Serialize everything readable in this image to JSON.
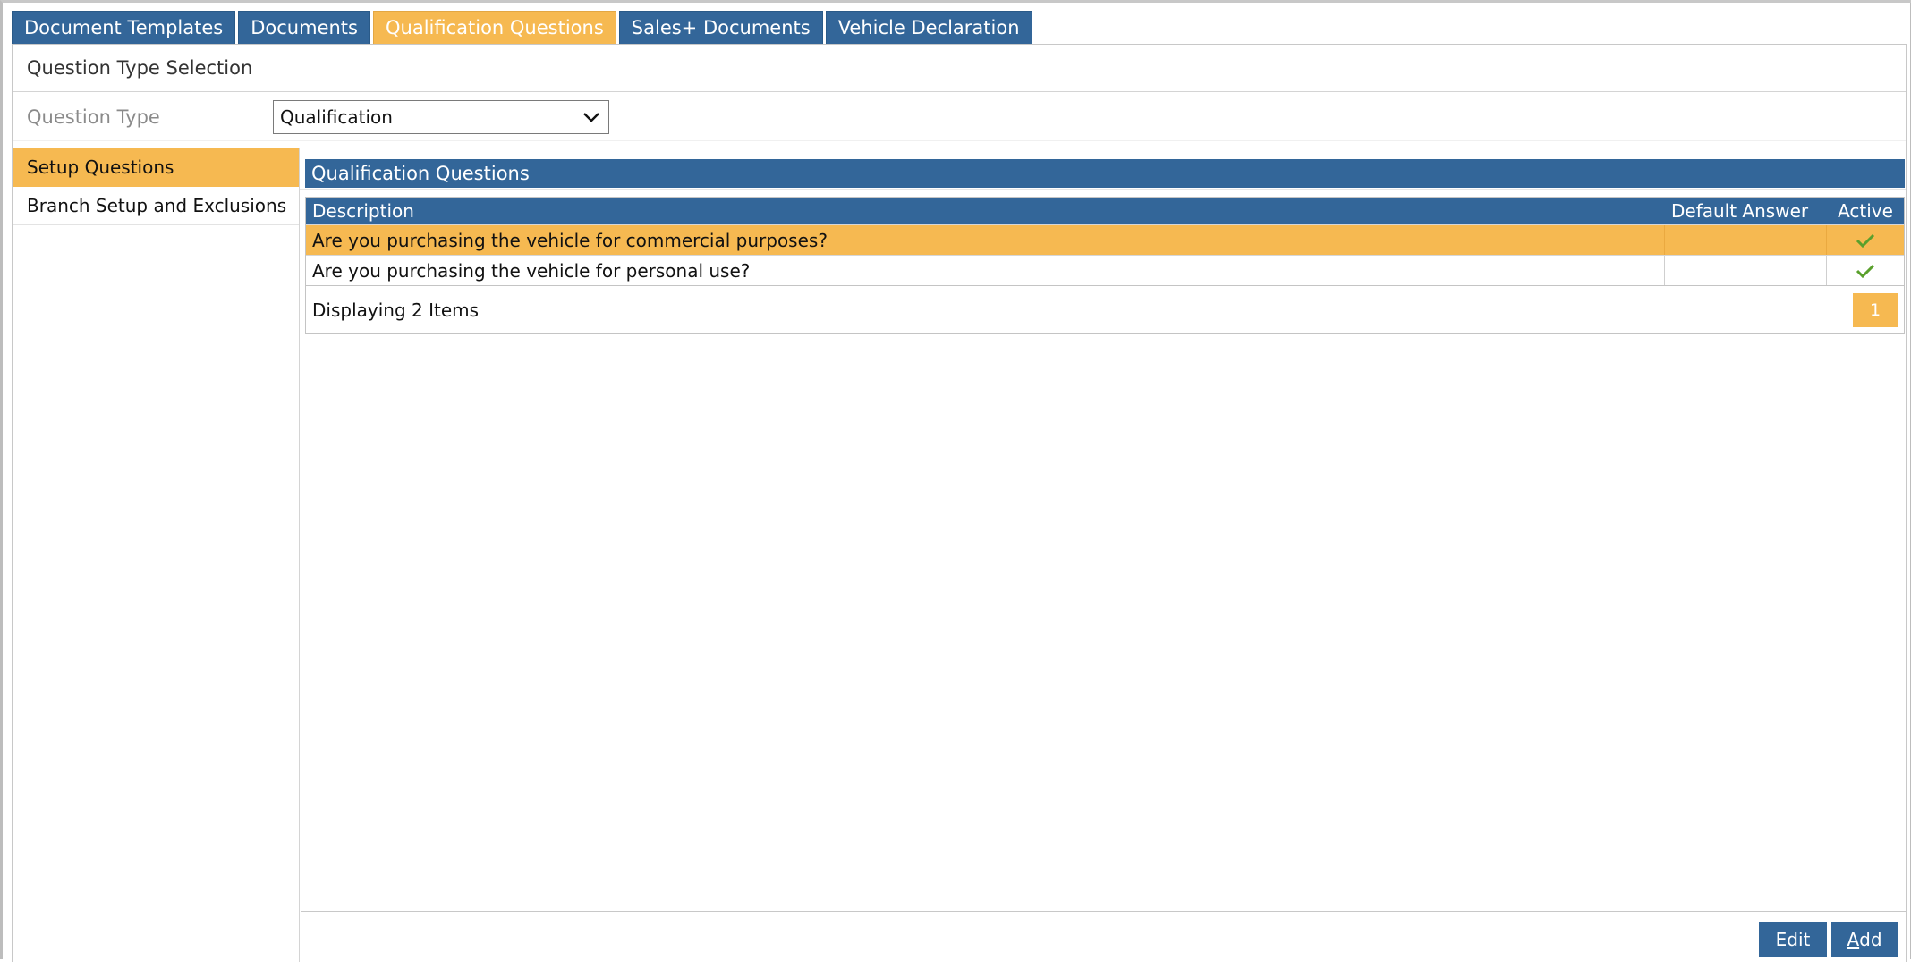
{
  "tabs": [
    {
      "label": "Document Templates",
      "active": false
    },
    {
      "label": "Documents",
      "active": false
    },
    {
      "label": "Qualification Questions",
      "active": true
    },
    {
      "label": "Sales+ Documents",
      "active": false
    },
    {
      "label": "Vehicle Declaration",
      "active": false
    }
  ],
  "section": {
    "title": "Question Type Selection",
    "question_type_label": "Question Type",
    "question_type_value": "Qualification"
  },
  "sidebar": {
    "items": [
      {
        "label": "Setup Questions",
        "active": true
      },
      {
        "label": "Branch Setup and Exclusions",
        "active": false
      }
    ]
  },
  "panel": {
    "title": "Qualification Questions",
    "columns": {
      "description": "Description",
      "default_answer": "Default Answer",
      "active": "Active"
    },
    "rows": [
      {
        "description": "Are you purchasing the vehicle for commercial purposes?",
        "default_answer": "",
        "active": "check-icon",
        "selected": true
      },
      {
        "description": "Are you purchasing the vehicle for personal use?",
        "default_answer": "",
        "active": "check-icon",
        "selected": false
      }
    ],
    "footer_text": "Displaying 2 Items",
    "current_page": "1"
  },
  "actions": {
    "edit_label": "Edit",
    "add_label_underlined": "A",
    "add_label_rest": "dd"
  },
  "colors": {
    "accent_blue": "#336699",
    "accent_orange": "#f6b951",
    "check_green": "#5aa02c"
  }
}
